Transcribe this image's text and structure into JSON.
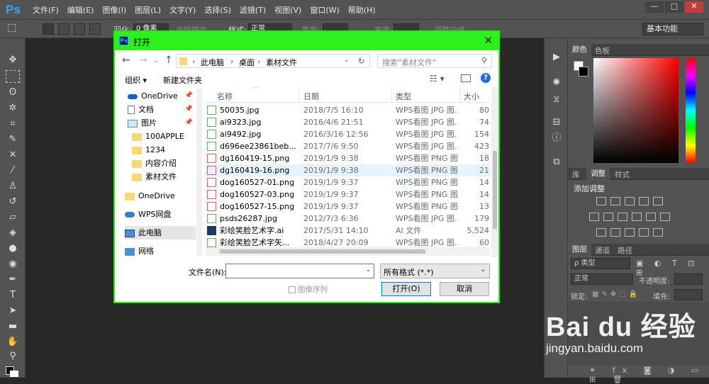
{
  "app": {
    "logo": "Ps"
  },
  "menu": [
    "文件(F)",
    "编辑(E)",
    "图像(I)",
    "图层(L)",
    "文字(Y)",
    "选择(S)",
    "滤镜(T)",
    "视图(V)",
    "窗口(W)",
    "帮助(H)"
  ],
  "window_controls": {
    "minimize": "—",
    "maximize": "□",
    "close": "✕"
  },
  "options": {
    "feather_label": "羽化:",
    "feather_value": "0 像素",
    "antialias": "消除锯齿",
    "style_label": "样式:",
    "style_value": "正常",
    "width_label": "宽度:",
    "height_label": "高度:",
    "refine_edge": "调整边缘...",
    "workspace": "基本功能"
  },
  "dialog": {
    "title": "打开",
    "path": [
      "此电脑",
      "桌面",
      "素材文件"
    ],
    "search_placeholder": "搜索\"素材文件\"",
    "organize": "组织 ▾",
    "new_folder": "新建文件夹",
    "sidebar": [
      {
        "label": "OneDrive",
        "pinned": true
      },
      {
        "label": "文档",
        "pinned": true
      },
      {
        "label": "图片",
        "pinned": true
      },
      {
        "label": "100APPLE",
        "pinned": false
      },
      {
        "label": "1234",
        "pinned": false
      },
      {
        "label": "内容介绍",
        "pinned": false
      },
      {
        "label": "素材文件",
        "pinned": false
      },
      {
        "label": "OneDrive",
        "pinned": false
      },
      {
        "label": "WPS网盘",
        "pinned": false
      },
      {
        "label": "此电脑",
        "pinned": false
      },
      {
        "label": "网络",
        "pinned": false
      }
    ],
    "columns": {
      "name": "名称",
      "date": "日期",
      "type": "类型",
      "size": "大小"
    },
    "files": [
      {
        "name": "50035.jpg",
        "date": "2018/7/5 16:10",
        "type": "WPS看图 JPG 图...",
        "size": "80"
      },
      {
        "name": "ai9323.jpg",
        "date": "2016/4/6 21:51",
        "type": "WPS看图 JPG 图...",
        "size": "74"
      },
      {
        "name": "ai9492.jpg",
        "date": "2016/3/16 12:56",
        "type": "WPS看图 JPG 图...",
        "size": "154"
      },
      {
        "name": "d696ee23861beb...",
        "date": "2017/7/6 9:50",
        "type": "WPS看图 JPG 图...",
        "size": "423"
      },
      {
        "name": "dg160419-15.png",
        "date": "2019/1/9 9:38",
        "type": "WPS看图 PNG 图...",
        "size": "18"
      },
      {
        "name": "dg160419-16.png",
        "date": "2019/1/9 9:38",
        "type": "WPS看图 PNG 图...",
        "size": "21"
      },
      {
        "name": "dog160527-01.png",
        "date": "2019/1/9 9:37",
        "type": "WPS看图 PNG 图...",
        "size": "14"
      },
      {
        "name": "dog160527-03.png",
        "date": "2019/1/9 9:37",
        "type": "WPS看图 PNG 图...",
        "size": "14"
      },
      {
        "name": "dog160527-15.png",
        "date": "2019/1/9 9:37",
        "type": "WPS看图 PNG 图...",
        "size": "13"
      },
      {
        "name": "psds26287.jpg",
        "date": "2012/7/3 6:36",
        "type": "WPS看图 JPG 图...",
        "size": "179"
      },
      {
        "name": "彩绘笑脸艺术字.ai",
        "date": "2017/5/31 14:10",
        "type": "AI 文件",
        "size": "5,524"
      },
      {
        "name": "彩绘笑脸艺术字矢...",
        "date": "2018/4/27 20:09",
        "type": "WPS看图 JPG 图...",
        "size": "60"
      }
    ],
    "filename_label": "文件名(N):",
    "filename_value": "",
    "filter_value": "所有格式 (*.*)",
    "image_sequence": "图像序列",
    "open_button": "打开(O)",
    "cancel_button": "取消"
  },
  "panels": {
    "color_tabs": [
      "颜色",
      "色板"
    ],
    "adjust_tabs": [
      "库",
      "调整",
      "样式"
    ],
    "adjust_title": "添加调整",
    "layer_tabs": [
      "图层",
      "通道",
      "路径"
    ],
    "layer_kind": "ρ 类型",
    "blend_mode": "正常",
    "opacity_label": "不透明度:",
    "lock_label": "锁定:",
    "fill_label": "填充:"
  },
  "watermark": {
    "main": "Bai du 经验",
    "url": "jingyan.baidu.com"
  }
}
